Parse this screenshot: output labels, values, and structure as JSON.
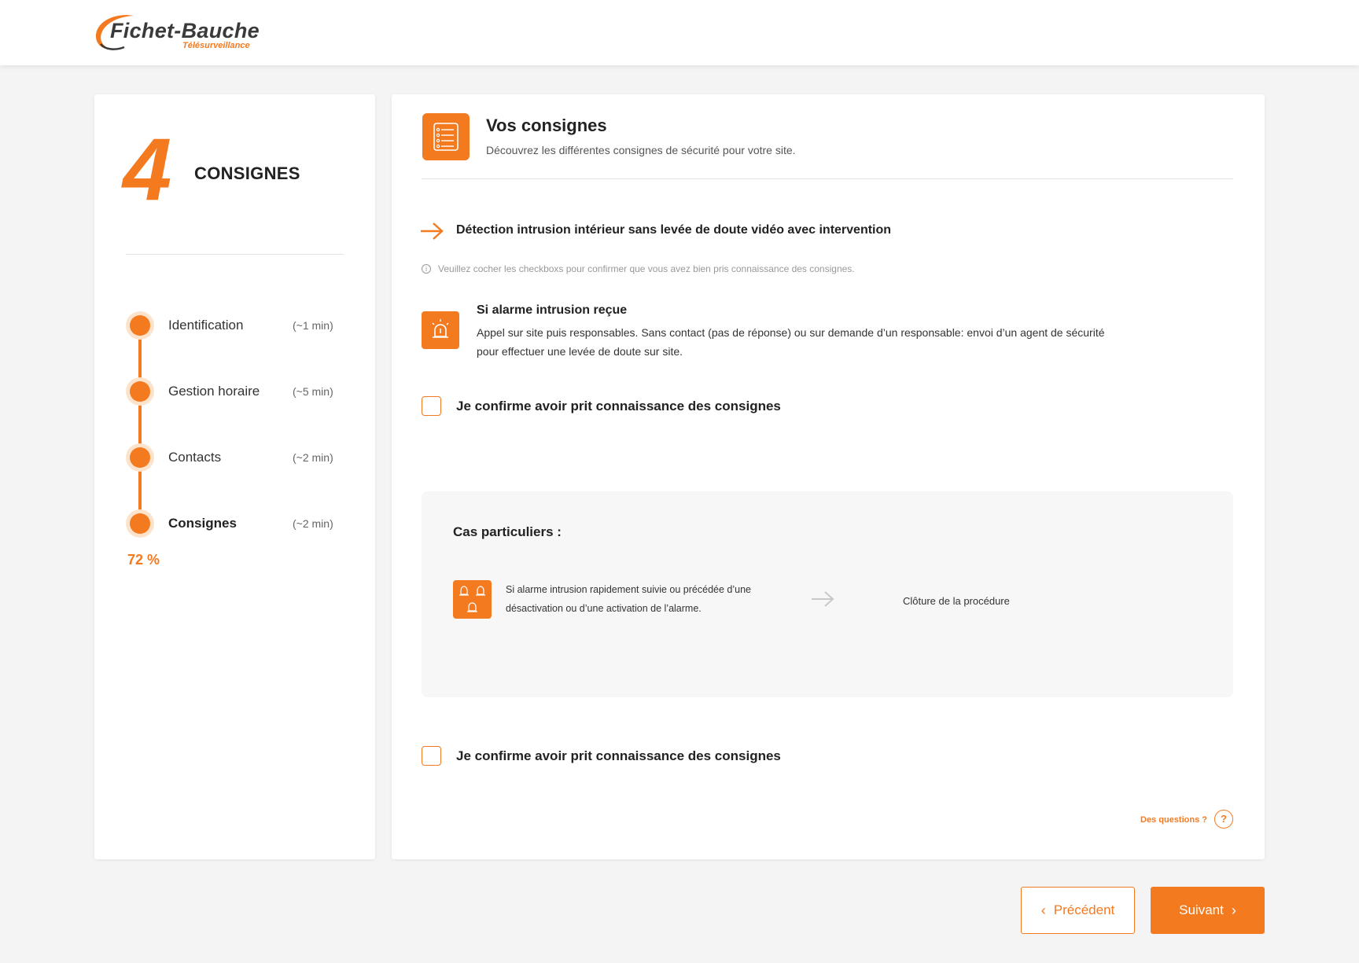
{
  "brand": {
    "name": "Fichet-Bauche",
    "tagline": "Télésurveillance",
    "accent": "#f47a20"
  },
  "sidebar": {
    "step_number": "4",
    "step_title": "CONSIGNES",
    "steps": [
      {
        "label": "Identification",
        "time": "(~1 min)"
      },
      {
        "label": "Gestion horaire",
        "time": "(~5 min)"
      },
      {
        "label": "Contacts",
        "time": "(~2 min)"
      },
      {
        "label": "Consignes",
        "time": "(~2 min)"
      }
    ],
    "progress": "72 %"
  },
  "main": {
    "title": "Vos consignes",
    "subtitle": "Découvrez les différentes consignes de sécurité pour votre site.",
    "detection_title": "Détection intrusion intérieur sans levée de doute vidéo avec intervention",
    "info_text": "Veuillez cocher les checkboxs pour confirmer que vous avez bien pris connaissance des consignes.",
    "alarm": {
      "title": "Si alarme intrusion reçue",
      "description": "Appel sur site puis responsables. Sans contact (pas de réponse) ou sur demande d’un responsable: envoi d’un agent de sécurité pour effectuer une levée de doute sur site."
    },
    "confirm_label": "Je confirme avoir prit connaissance des consignes",
    "special_cases": {
      "title": "Cas particuliers :",
      "case_description": "Si alarme intrusion rapidement suivie ou précédée d’une désactivation ou d’une activation de l’alarme.",
      "case_result": "Clôture de la procédure"
    },
    "questions_label": "Des questions ?"
  },
  "nav": {
    "prev_label": "Précédent",
    "next_label": "Suivant"
  }
}
